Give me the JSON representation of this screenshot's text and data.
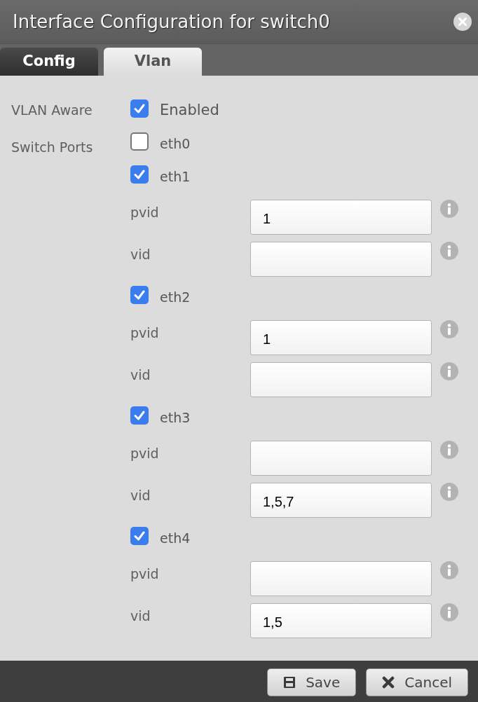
{
  "window": {
    "title": "Interface Configuration for switch0"
  },
  "tabs": [
    {
      "label": "Config",
      "selected": false
    },
    {
      "label": "Vlan",
      "selected": true
    }
  ],
  "vlan_aware": {
    "label": "VLAN Aware",
    "option": "Enabled",
    "checked": true
  },
  "switch_ports": {
    "label": "Switch Ports",
    "ports": [
      {
        "name": "eth0",
        "checked": false
      },
      {
        "name": "eth1",
        "checked": true,
        "fields": [
          {
            "label": "pvid",
            "value": "1"
          },
          {
            "label": "vid"
          }
        ]
      },
      {
        "name": "eth2",
        "checked": true,
        "fields": [
          {
            "label": "pvid",
            "value": "1"
          },
          {
            "label": "vid"
          }
        ]
      },
      {
        "name": "eth3",
        "checked": true,
        "fields": [
          {
            "label": "pvid"
          },
          {
            "label": "vid",
            "value": "1,5,7"
          }
        ]
      },
      {
        "name": "eth4",
        "checked": true,
        "fields": [
          {
            "label": "pvid"
          },
          {
            "label": "vid",
            "value": "1,5"
          }
        ]
      }
    ]
  },
  "buttons": [
    {
      "kind": "save",
      "label": "Save"
    },
    {
      "kind": "cancel",
      "label": "Cancel"
    }
  ]
}
